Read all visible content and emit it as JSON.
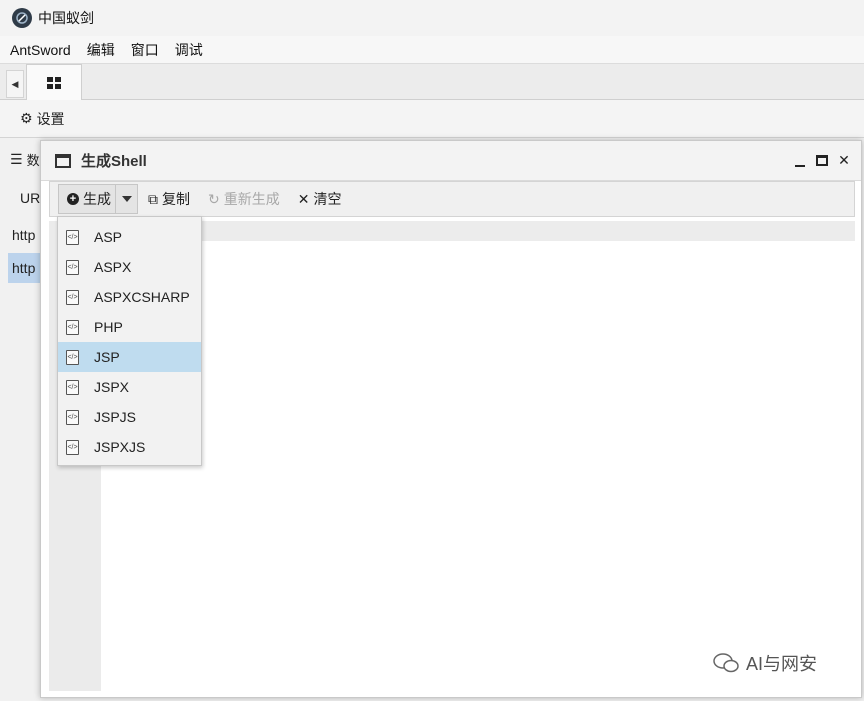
{
  "window": {
    "title": "中国蚁剑"
  },
  "menubar": {
    "items": [
      "AntSword",
      "编辑",
      "窗口",
      "调试"
    ]
  },
  "toolbar": {
    "settings_label": "设置"
  },
  "background": {
    "list_header": "数",
    "column_header": "UR",
    "rows": [
      "http",
      "http"
    ]
  },
  "dialog": {
    "title": "生成Shell",
    "toolbar": {
      "generate_label": "生成",
      "copy_label": "复制",
      "regenerate_label": "重新生成",
      "clear_label": "清空"
    },
    "dropdown": {
      "items": [
        "ASP",
        "ASPX",
        "ASPXCSHARP",
        "PHP",
        "JSP",
        "JSPX",
        "JSPJS",
        "JSPXJS"
      ],
      "highlighted": "JSP"
    }
  },
  "watermark": {
    "text": "AI与网安"
  }
}
